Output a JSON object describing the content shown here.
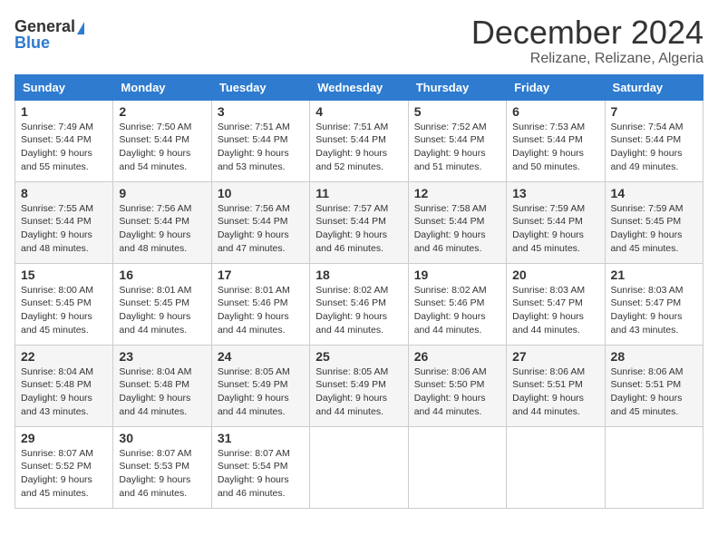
{
  "logo": {
    "general": "General",
    "blue": "Blue"
  },
  "title": {
    "month": "December 2024",
    "location": "Relizane, Relizane, Algeria"
  },
  "weekdays": [
    "Sunday",
    "Monday",
    "Tuesday",
    "Wednesday",
    "Thursday",
    "Friday",
    "Saturday"
  ],
  "weeks": [
    [
      {
        "day": "1",
        "sunrise": "7:49 AM",
        "sunset": "5:44 PM",
        "daylight": "9 hours and 55 minutes."
      },
      {
        "day": "2",
        "sunrise": "7:50 AM",
        "sunset": "5:44 PM",
        "daylight": "9 hours and 54 minutes."
      },
      {
        "day": "3",
        "sunrise": "7:51 AM",
        "sunset": "5:44 PM",
        "daylight": "9 hours and 53 minutes."
      },
      {
        "day": "4",
        "sunrise": "7:51 AM",
        "sunset": "5:44 PM",
        "daylight": "9 hours and 52 minutes."
      },
      {
        "day": "5",
        "sunrise": "7:52 AM",
        "sunset": "5:44 PM",
        "daylight": "9 hours and 51 minutes."
      },
      {
        "day": "6",
        "sunrise": "7:53 AM",
        "sunset": "5:44 PM",
        "daylight": "9 hours and 50 minutes."
      },
      {
        "day": "7",
        "sunrise": "7:54 AM",
        "sunset": "5:44 PM",
        "daylight": "9 hours and 49 minutes."
      }
    ],
    [
      {
        "day": "8",
        "sunrise": "7:55 AM",
        "sunset": "5:44 PM",
        "daylight": "9 hours and 48 minutes."
      },
      {
        "day": "9",
        "sunrise": "7:56 AM",
        "sunset": "5:44 PM",
        "daylight": "9 hours and 48 minutes."
      },
      {
        "day": "10",
        "sunrise": "7:56 AM",
        "sunset": "5:44 PM",
        "daylight": "9 hours and 47 minutes."
      },
      {
        "day": "11",
        "sunrise": "7:57 AM",
        "sunset": "5:44 PM",
        "daylight": "9 hours and 46 minutes."
      },
      {
        "day": "12",
        "sunrise": "7:58 AM",
        "sunset": "5:44 PM",
        "daylight": "9 hours and 46 minutes."
      },
      {
        "day": "13",
        "sunrise": "7:59 AM",
        "sunset": "5:44 PM",
        "daylight": "9 hours and 45 minutes."
      },
      {
        "day": "14",
        "sunrise": "7:59 AM",
        "sunset": "5:45 PM",
        "daylight": "9 hours and 45 minutes."
      }
    ],
    [
      {
        "day": "15",
        "sunrise": "8:00 AM",
        "sunset": "5:45 PM",
        "daylight": "9 hours and 45 minutes."
      },
      {
        "day": "16",
        "sunrise": "8:01 AM",
        "sunset": "5:45 PM",
        "daylight": "9 hours and 44 minutes."
      },
      {
        "day": "17",
        "sunrise": "8:01 AM",
        "sunset": "5:46 PM",
        "daylight": "9 hours and 44 minutes."
      },
      {
        "day": "18",
        "sunrise": "8:02 AM",
        "sunset": "5:46 PM",
        "daylight": "9 hours and 44 minutes."
      },
      {
        "day": "19",
        "sunrise": "8:02 AM",
        "sunset": "5:46 PM",
        "daylight": "9 hours and 44 minutes."
      },
      {
        "day": "20",
        "sunrise": "8:03 AM",
        "sunset": "5:47 PM",
        "daylight": "9 hours and 44 minutes."
      },
      {
        "day": "21",
        "sunrise": "8:03 AM",
        "sunset": "5:47 PM",
        "daylight": "9 hours and 43 minutes."
      }
    ],
    [
      {
        "day": "22",
        "sunrise": "8:04 AM",
        "sunset": "5:48 PM",
        "daylight": "9 hours and 43 minutes."
      },
      {
        "day": "23",
        "sunrise": "8:04 AM",
        "sunset": "5:48 PM",
        "daylight": "9 hours and 44 minutes."
      },
      {
        "day": "24",
        "sunrise": "8:05 AM",
        "sunset": "5:49 PM",
        "daylight": "9 hours and 44 minutes."
      },
      {
        "day": "25",
        "sunrise": "8:05 AM",
        "sunset": "5:49 PM",
        "daylight": "9 hours and 44 minutes."
      },
      {
        "day": "26",
        "sunrise": "8:06 AM",
        "sunset": "5:50 PM",
        "daylight": "9 hours and 44 minutes."
      },
      {
        "day": "27",
        "sunrise": "8:06 AM",
        "sunset": "5:51 PM",
        "daylight": "9 hours and 44 minutes."
      },
      {
        "day": "28",
        "sunrise": "8:06 AM",
        "sunset": "5:51 PM",
        "daylight": "9 hours and 45 minutes."
      }
    ],
    [
      {
        "day": "29",
        "sunrise": "8:07 AM",
        "sunset": "5:52 PM",
        "daylight": "9 hours and 45 minutes."
      },
      {
        "day": "30",
        "sunrise": "8:07 AM",
        "sunset": "5:53 PM",
        "daylight": "9 hours and 46 minutes."
      },
      {
        "day": "31",
        "sunrise": "8:07 AM",
        "sunset": "5:54 PM",
        "daylight": "9 hours and 46 minutes."
      },
      null,
      null,
      null,
      null
    ]
  ]
}
